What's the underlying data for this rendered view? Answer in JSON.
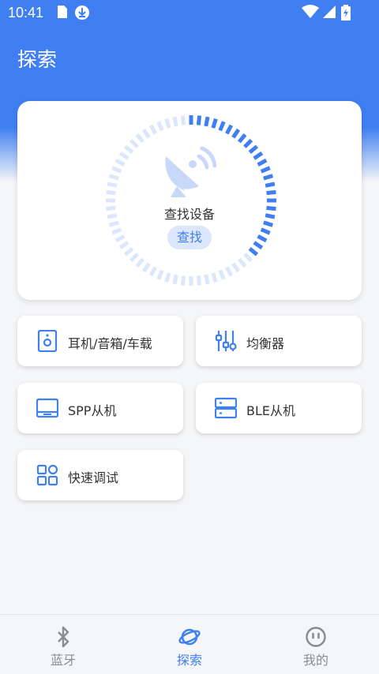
{
  "status_bar": {
    "time": "10:41"
  },
  "header": {
    "title": "探索"
  },
  "search_card": {
    "label": "查找设备",
    "button_label": "查找"
  },
  "tiles": [
    {
      "label": "耳机/音箱/车载",
      "icon": "speaker-icon"
    },
    {
      "label": "均衡器",
      "icon": "equalizer-icon"
    },
    {
      "label": "SPP从机",
      "icon": "monitor-icon"
    },
    {
      "label": "BLE从机",
      "icon": "server-icon"
    },
    {
      "label": "快速调试",
      "icon": "grid-icon"
    }
  ],
  "bottom_nav": {
    "items": [
      {
        "label": "蓝牙",
        "icon": "bluetooth-icon",
        "active": false
      },
      {
        "label": "探索",
        "icon": "planet-icon",
        "active": true
      },
      {
        "label": "我的",
        "icon": "face-icon",
        "active": false
      }
    ]
  },
  "colors": {
    "accent": "#3f7ff1",
    "accent_light": "#dde7fb",
    "inactive": "#8a8c90",
    "background": "#f5f6f8"
  }
}
